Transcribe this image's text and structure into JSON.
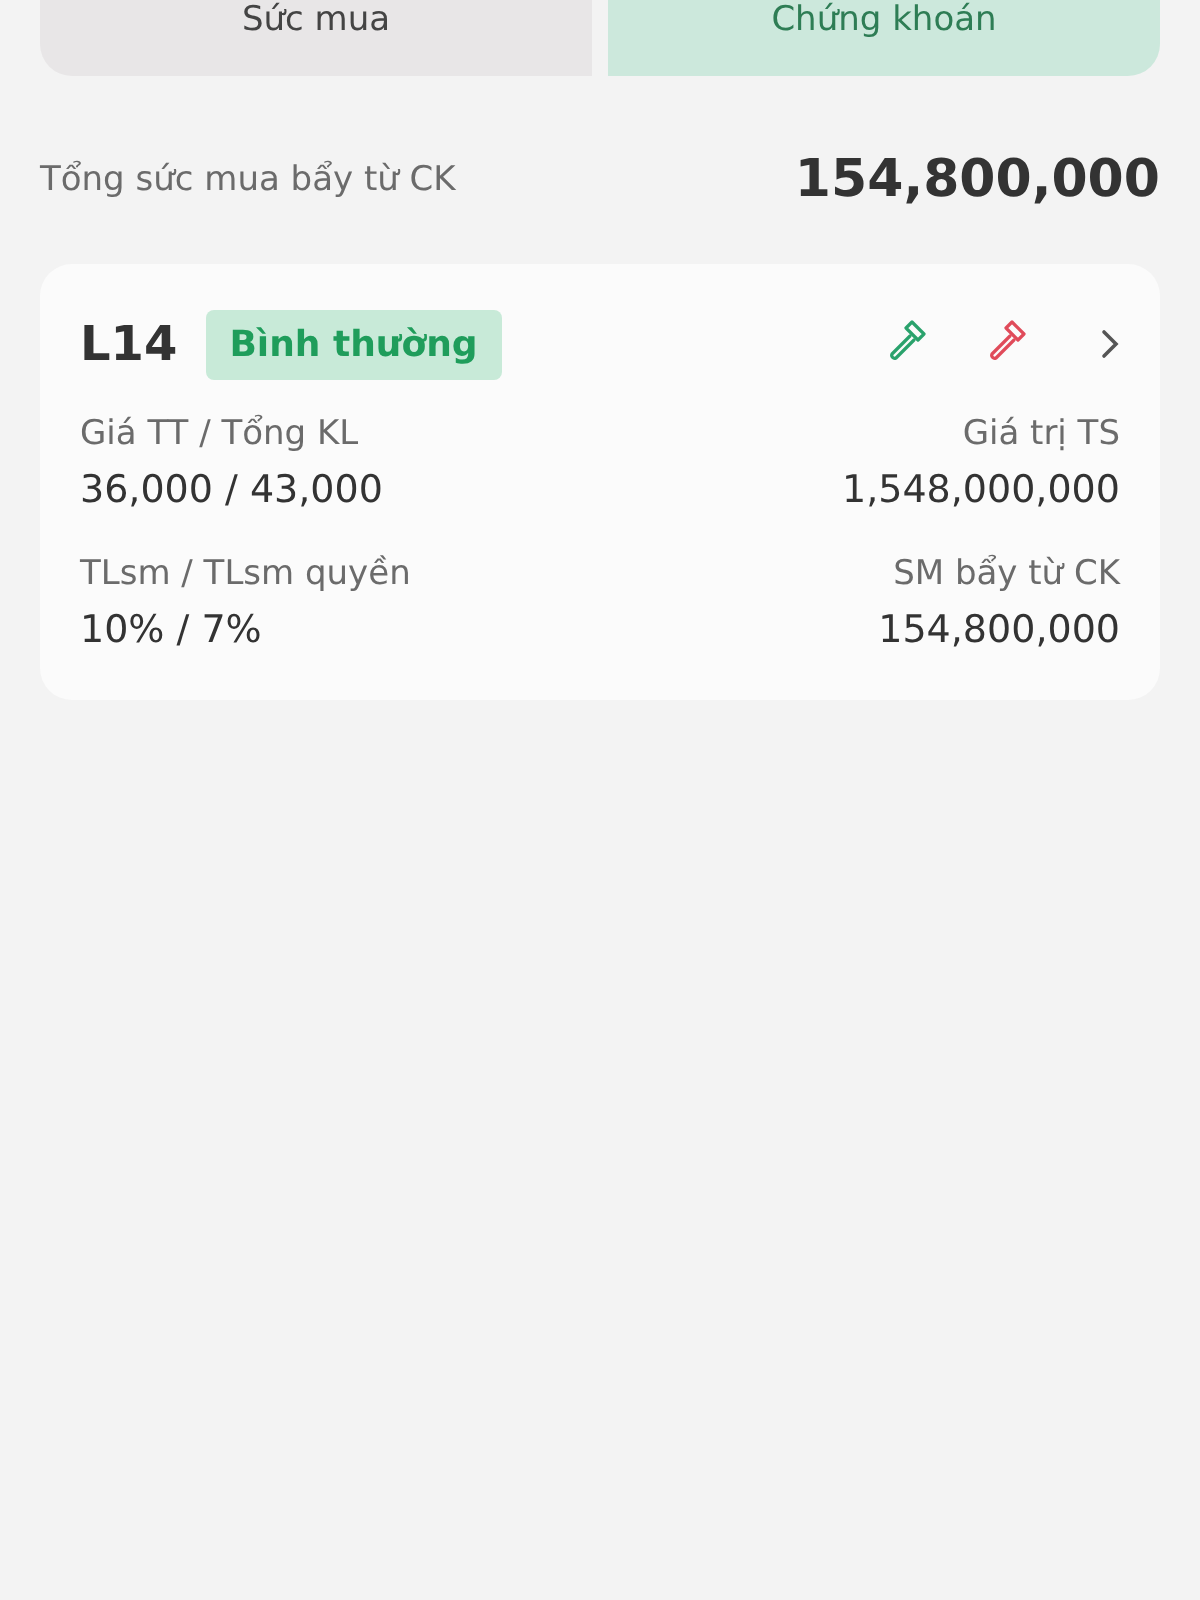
{
  "tabs": [
    {
      "label": "Sức mua",
      "selected": false
    },
    {
      "label": "Chứng khoán",
      "selected": true
    }
  ],
  "summary": {
    "label": "Tổng sức mua bẩy từ CK",
    "value": "154,800,000"
  },
  "cards": [
    {
      "code": "L14",
      "status": "Bình thường",
      "fields": [
        {
          "label": "Giá TT / Tổng KL",
          "value": "36,000 / 43,000"
        },
        {
          "label": "Giá trị TS",
          "value": "1,548,000,000"
        },
        {
          "label": "TLsm / TLsm quyền",
          "value": "10% / 7%"
        },
        {
          "label": "SM bẩy từ CK",
          "value": "154,800,000"
        }
      ]
    }
  ]
}
